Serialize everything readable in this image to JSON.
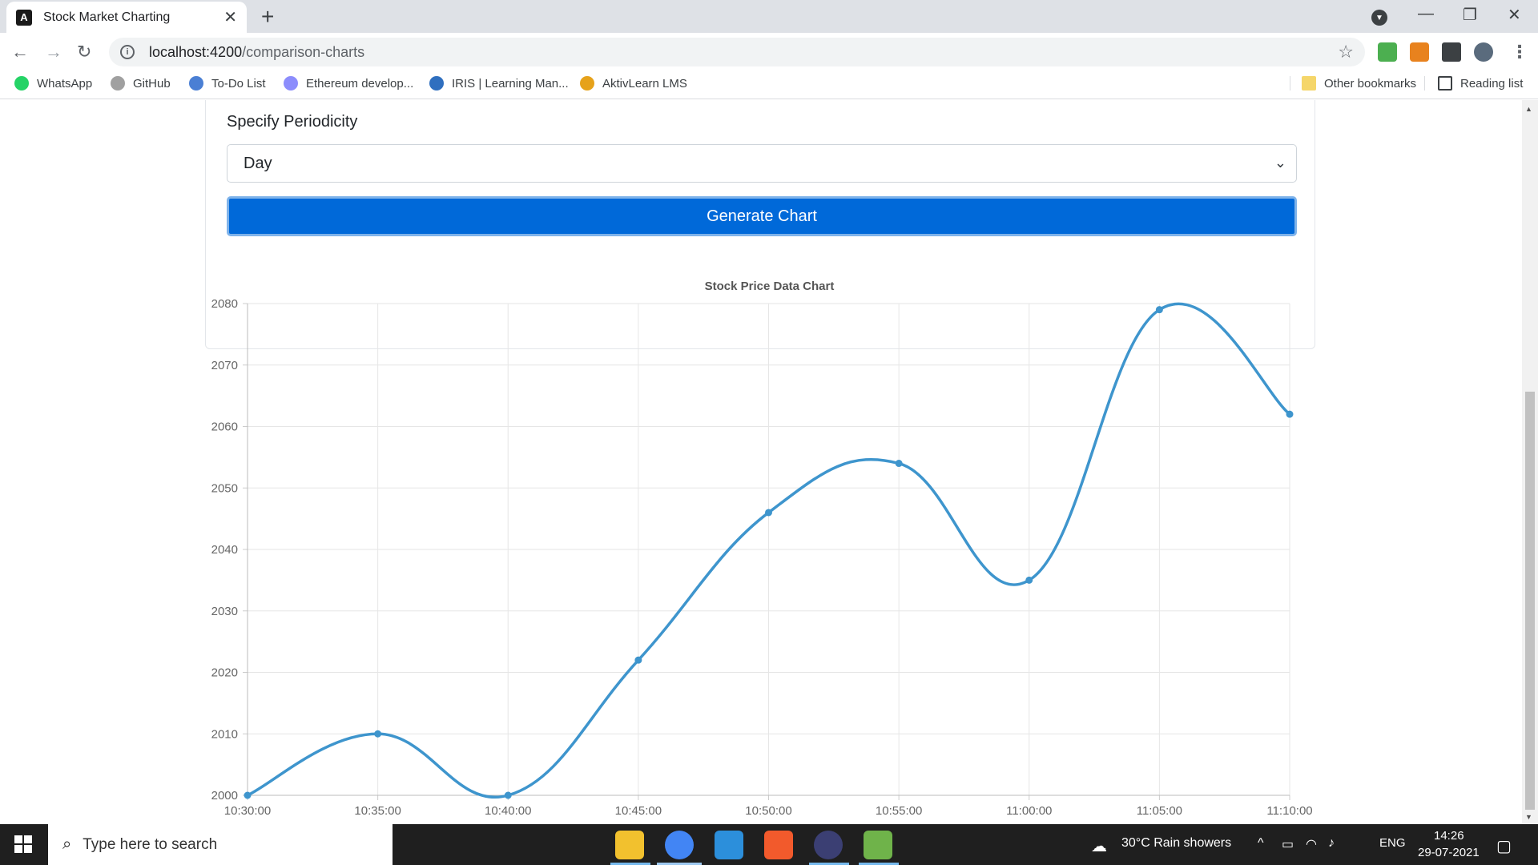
{
  "browser": {
    "tab_title": "Stock Market Charting",
    "tab_favicon": "angular-icon",
    "url_host": "localhost:4200",
    "url_path": "/comparison-charts",
    "bookmarks": [
      {
        "label": "WhatsApp",
        "color": "#25d366"
      },
      {
        "label": "GitHub",
        "color": "#a0a0a0"
      },
      {
        "label": "To-Do List",
        "color": "#4a7fd4"
      },
      {
        "label": "Ethereum develop...",
        "color": "#8c8dfc"
      },
      {
        "label": "IRIS | Learning Man...",
        "color": "#2f6fbf"
      },
      {
        "label": "AktivLearn LMS",
        "color": "#e6a21a"
      }
    ],
    "other_bookmarks": "Other bookmarks",
    "reading_list": "Reading list"
  },
  "form": {
    "periodicity_label": "Specify Periodicity",
    "periodicity_value": "Day",
    "generate_button": "Generate Chart"
  },
  "chart_data": {
    "type": "line",
    "title": "Stock Price Data Chart",
    "x": [
      "10:30:00",
      "10:35:00",
      "10:40:00",
      "10:45:00",
      "10:50:00",
      "10:55:00",
      "11:00:00",
      "11:05:00",
      "11:10:00"
    ],
    "series": [
      {
        "name": "",
        "values": [
          2000,
          2010,
          2000,
          2022,
          2046,
          2054,
          2035,
          2079,
          2062
        ],
        "color": "#3e95cd"
      }
    ],
    "ylim": [
      2000,
      2080
    ],
    "yticks": [
      2000,
      2010,
      2020,
      2030,
      2040,
      2050,
      2060,
      2070,
      2080
    ],
    "grid": true,
    "xlabel": "",
    "ylabel": ""
  },
  "taskbar": {
    "search_placeholder": "Type here to search",
    "weather": "30°C  Rain showers",
    "language": "ENG",
    "time": "14:26",
    "date": "29-07-2021"
  }
}
